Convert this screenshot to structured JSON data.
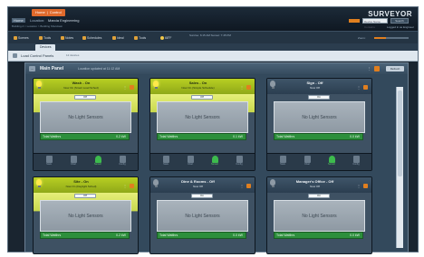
{
  "app": {
    "tab_left": "Home",
    "tab_right": "Control",
    "home_button": "Home",
    "location_label": "Location:",
    "location_name": "Marcia Engineering",
    "status_line": "Building A > Location > Building Shutdown",
    "brand": "SURVEYOR",
    "search_placeholder": "Device Name Contains",
    "search_button": "Search",
    "user_line": "Logged in as Engineer"
  },
  "toolbar": {
    "items": [
      "Scenes",
      "Tools",
      "Notes",
      "Schedules",
      "Ideal",
      "Tools"
    ],
    "sun_label": "68°F",
    "status_text": "Sunrise: 6:15 AM  Sunset: 7:45 PM",
    "zoom_label": "Zoom:",
    "zoom_fraction": 0.35
  },
  "tabstrip": {
    "tab": "Devices"
  },
  "subheader": {
    "title": "Load Control Panels",
    "meta": "12 devices"
  },
  "panel": {
    "title": "Main Panel",
    "subtitle": "Location updated at 11:12 AM",
    "button": "Refresh",
    "menu_glyph": "⋮"
  },
  "cards": [
    {
      "title": "Wash - On",
      "sub": "Now On (Smart Load Sched)",
      "on": true,
      "button": "Off",
      "preview": "No Light Sensors",
      "total_label": "Total Watthrs",
      "total_value": "0.2 kW",
      "foot": [
        "Stats",
        "Chart",
        "Sensor",
        "Config"
      ],
      "state": "on"
    },
    {
      "title": "Sales - On",
      "sub": "Now On (Simple Schedule)",
      "on": true,
      "button": "Off",
      "preview": "No Light Sensors",
      "total_label": "Total Watthrs",
      "total_value": "0.1 kW",
      "foot": [
        "Stats",
        "Chart",
        "Sensor",
        "Config"
      ],
      "state": "on"
    },
    {
      "title": "Sign - Off",
      "sub": "Now Off",
      "on": false,
      "button": "On",
      "preview": "No Light Sensors",
      "total_label": "Total Watthrs",
      "total_value": "0.0 kW",
      "foot": [
        "Stats",
        "Chart",
        "Sensor",
        "Config"
      ],
      "state": "off"
    },
    {
      "title": "Site - On",
      "sub": "Now On (Daylight Sched)",
      "on": true,
      "button": "Off",
      "preview": "No Light Sensors",
      "total_label": "Total Watthrs",
      "total_value": "0.2 kW",
      "foot": [
        "Stats",
        "Chart",
        "Sensor",
        "Config"
      ],
      "state": "on"
    },
    {
      "title": "Dine & Rooms - Off",
      "sub": "Now Off",
      "on": false,
      "button": "On",
      "preview": "No Light Sensors",
      "total_label": "Total Watthrs",
      "total_value": "0.0 kW",
      "foot": [
        "Stats",
        "Chart",
        "Sensor",
        "Config"
      ],
      "state": "off"
    },
    {
      "title": "Manager's Office - Off",
      "sub": "Now Off",
      "on": false,
      "button": "On",
      "preview": "No Light Sensors",
      "total_label": "Total Watthrs",
      "total_value": "0.0 kW",
      "foot": [
        "Stats",
        "Chart",
        "Sensor",
        "Config"
      ],
      "state": "off"
    }
  ],
  "colors": {
    "accent": "#e07f1f",
    "on_header": "#b8cf23",
    "total_bar": "#2d8f3c"
  }
}
